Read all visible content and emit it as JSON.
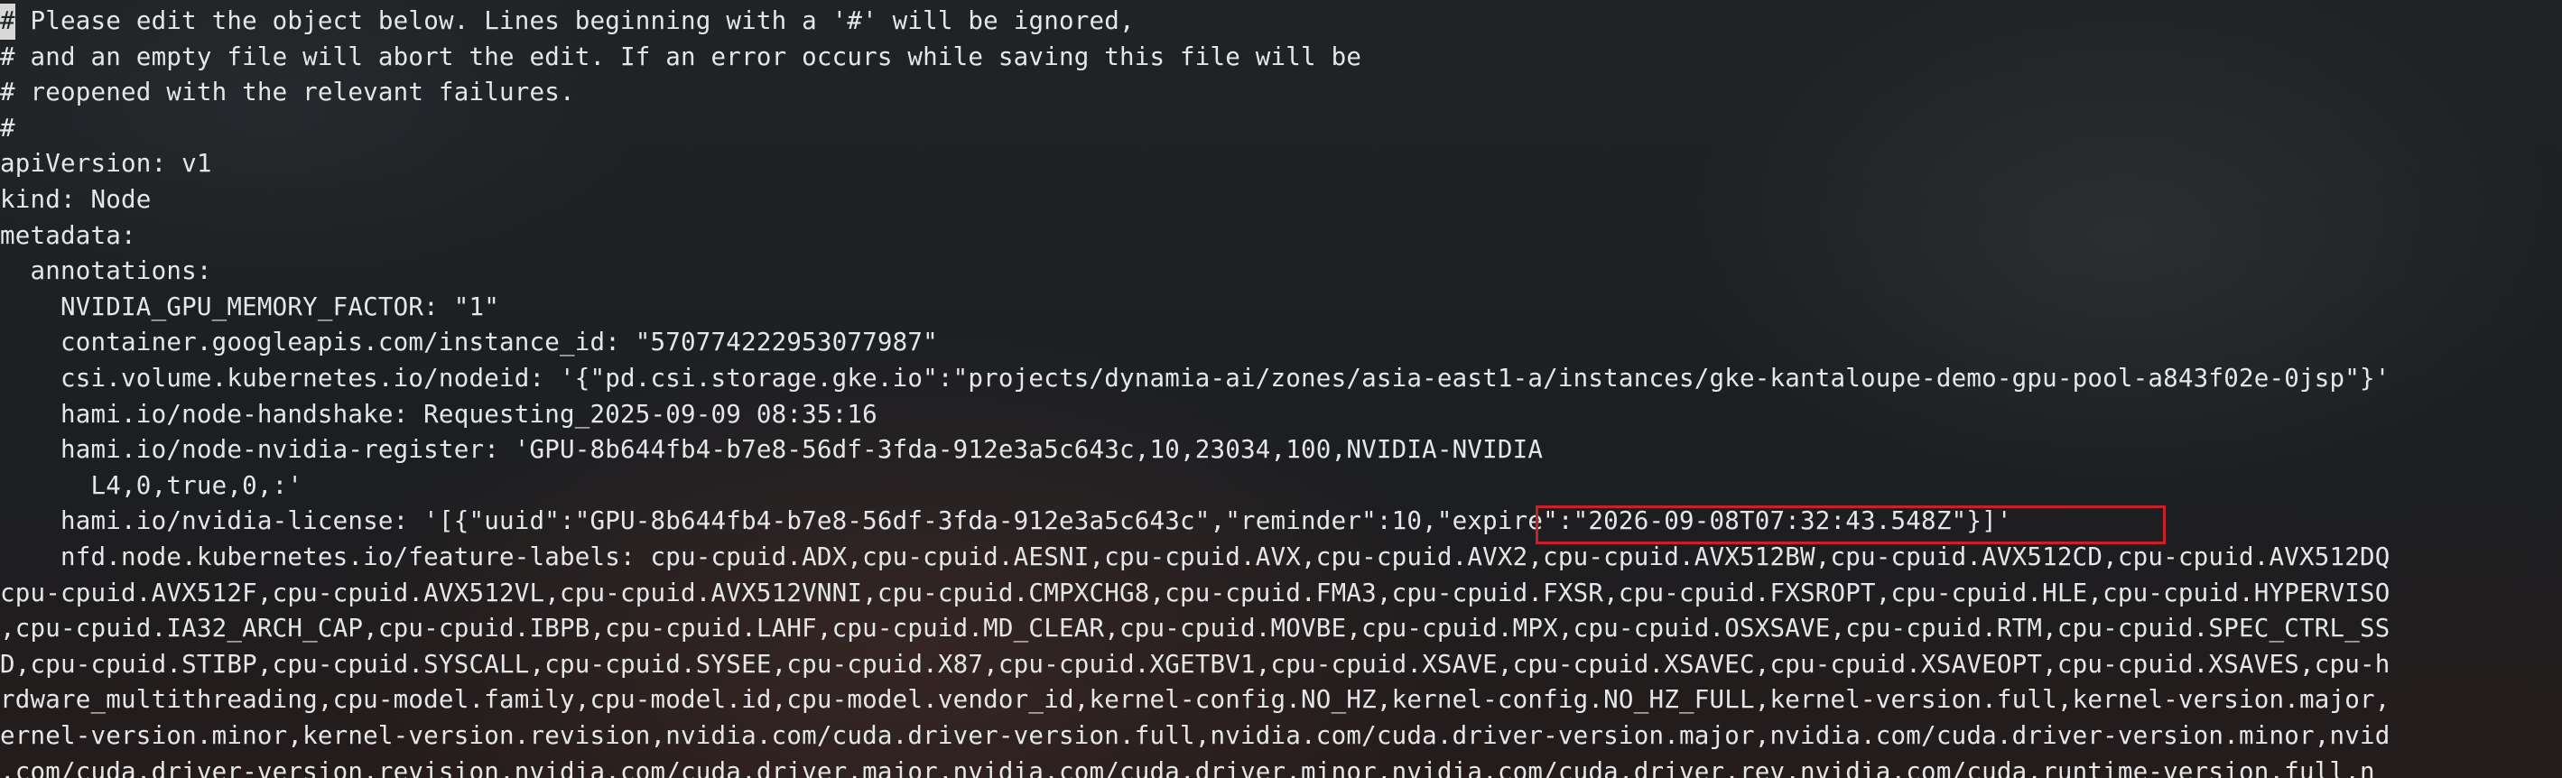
{
  "terminal": {
    "lines": [
      {
        "cursor_char": "#",
        "text": " Please edit the object below. Lines beginning with a '#' will be ignored,"
      },
      {
        "text": "# and an empty file will abort the edit. If an error occurs while saving this file will be"
      },
      {
        "text": "# reopened with the relevant failures."
      },
      {
        "text": "#"
      },
      {
        "text": "apiVersion: v1"
      },
      {
        "text": "kind: Node"
      },
      {
        "text": "metadata:"
      },
      {
        "text": "  annotations:"
      },
      {
        "text": "    NVIDIA_GPU_MEMORY_FACTOR: \"1\""
      },
      {
        "text": "    container.googleapis.com/instance_id: \"570774222953077987\""
      },
      {
        "text": "    csi.volume.kubernetes.io/nodeid: '{\"pd.csi.storage.gke.io\":\"projects/dynamia-ai/zones/asia-east1-a/instances/gke-kantaloupe-demo-gpu-pool-a843f02e-0jsp\"}'"
      },
      {
        "text": "    hami.io/node-handshake: Requesting_2025-09-09 08:35:16"
      },
      {
        "text": "    hami.io/node-nvidia-register: 'GPU-8b644fb4-b7e8-56df-3fda-912e3a5c643c,10,23034,100,NVIDIA-NVIDIA"
      },
      {
        "text": "      L4,0,true,0,:'"
      },
      {
        "text": "    hami.io/nvidia-license: '[{\"uuid\":\"GPU-8b644fb4-b7e8-56df-3fda-912e3a5c643c\",\"reminder\":10,\"expire\":\"2026-09-08T07:32:43.548Z\"}]'"
      },
      {
        "text": "    nfd.node.kubernetes.io/feature-labels: cpu-cpuid.ADX,cpu-cpuid.AESNI,cpu-cpuid.AVX,cpu-cpuid.AVX2,cpu-cpuid.AVX512BW,cpu-cpuid.AVX512CD,cpu-cpuid.AVX512DQ"
      },
      {
        "text": "cpu-cpuid.AVX512F,cpu-cpuid.AVX512VL,cpu-cpuid.AVX512VNNI,cpu-cpuid.CMPXCHG8,cpu-cpuid.FMA3,cpu-cpuid.FXSR,cpu-cpuid.FXSROPT,cpu-cpuid.HLE,cpu-cpuid.HYPERVISO"
      },
      {
        "text": ",cpu-cpuid.IA32_ARCH_CAP,cpu-cpuid.IBPB,cpu-cpuid.LAHF,cpu-cpuid.MD_CLEAR,cpu-cpuid.MOVBE,cpu-cpuid.MPX,cpu-cpuid.OSXSAVE,cpu-cpuid.RTM,cpu-cpuid.SPEC_CTRL_SS"
      },
      {
        "text": "D,cpu-cpuid.STIBP,cpu-cpuid.SYSCALL,cpu-cpuid.SYSEE,cpu-cpuid.X87,cpu-cpuid.XGETBV1,cpu-cpuid.XSAVE,cpu-cpuid.XSAVEC,cpu-cpuid.XSAVEOPT,cpu-cpuid.XSAVES,cpu-h"
      },
      {
        "text": "rdware_multithreading,cpu-model.family,cpu-model.id,cpu-model.vendor_id,kernel-config.NO_HZ,kernel-config.NO_HZ_FULL,kernel-version.full,kernel-version.major,"
      },
      {
        "text": "ernel-version.minor,kernel-version.revision,nvidia.com/cuda.driver-version.full,nvidia.com/cuda.driver-version.major,nvidia.com/cuda.driver-version.minor,nvid"
      },
      {
        "text": ".com/cuda.driver-version.revision,nvidia.com/cuda.driver.major,nvidia.com/cuda.driver.minor,nvidia.com/cuda.driver.rev,nvidia.com/cuda.runtime-version.full,n"
      }
    ],
    "highlight": {
      "text": "\"expire\":\"2026-09-08T07:32:43.548Z\"}]'",
      "color": "#c8212b"
    },
    "colors": {
      "foreground": "#e4e6e8",
      "background": "#1f2225"
    }
  }
}
